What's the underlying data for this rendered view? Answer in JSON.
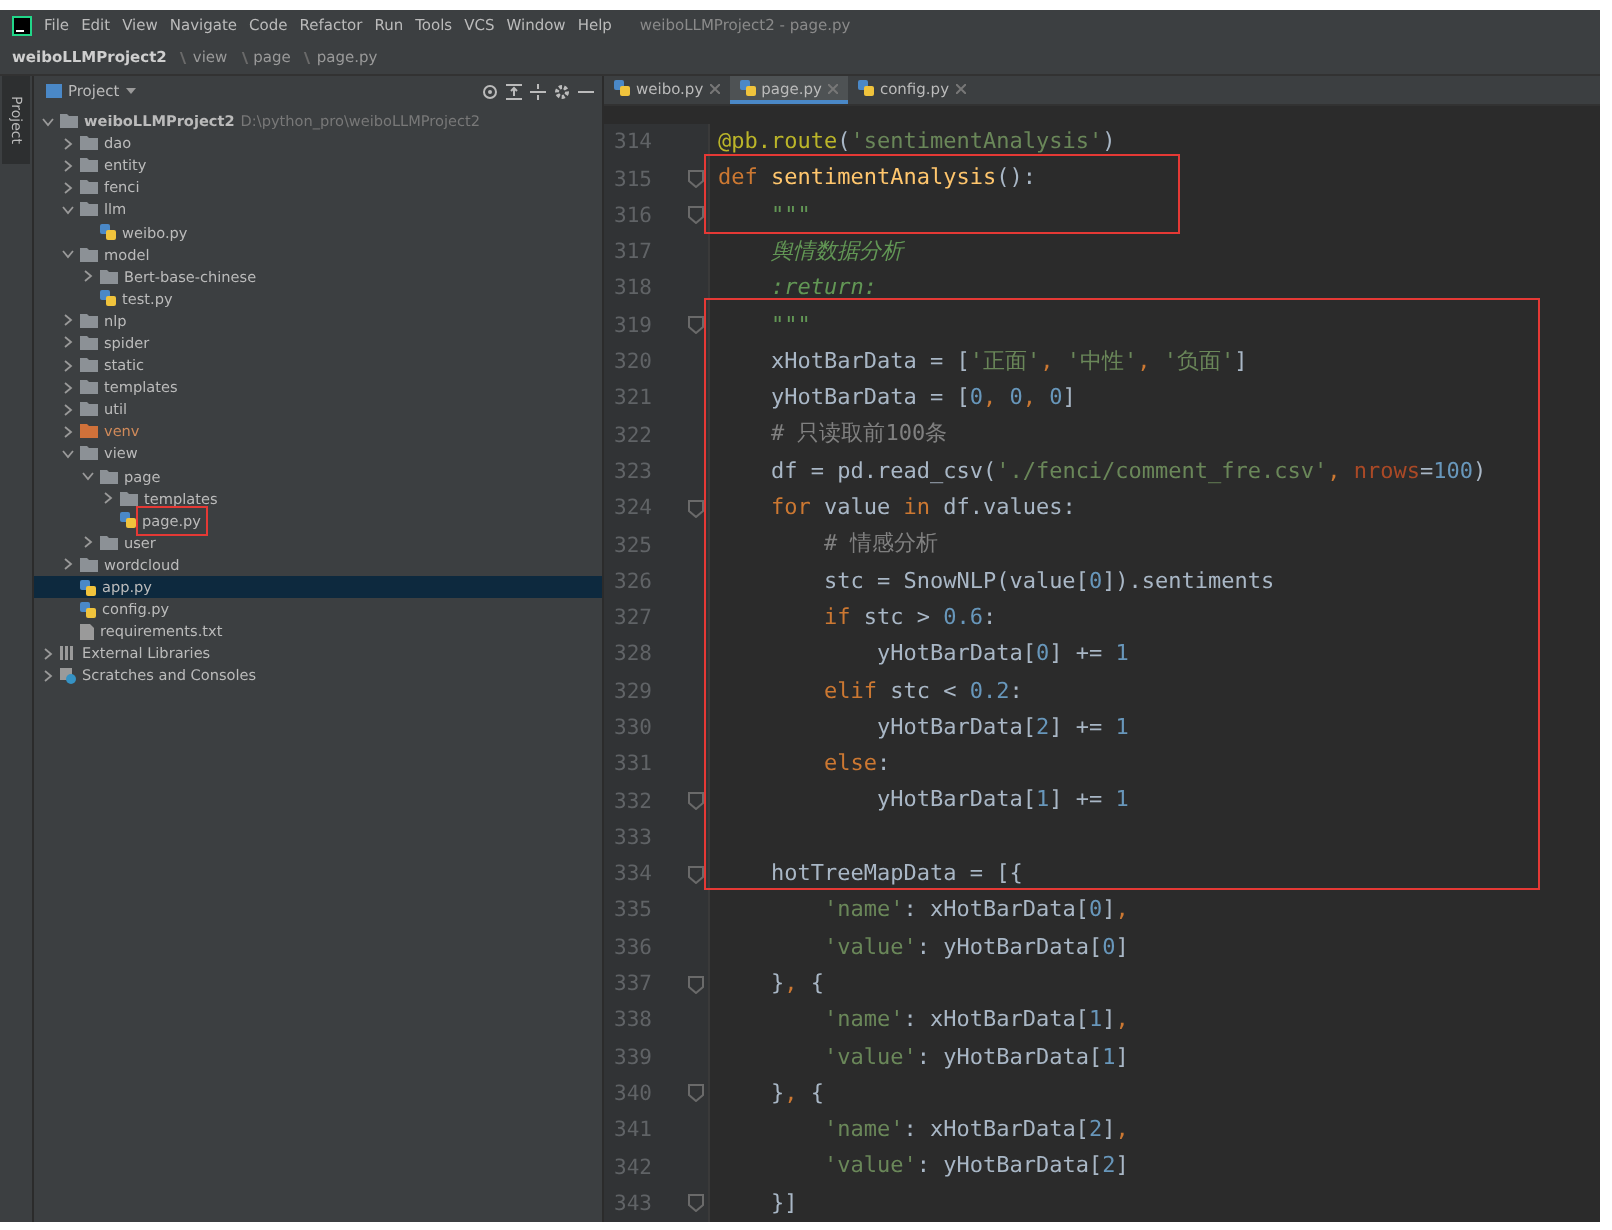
{
  "menu_bar": {
    "items": [
      "File",
      "Edit",
      "View",
      "Navigate",
      "Code",
      "Refactor",
      "Run",
      "Tools",
      "VCS",
      "Window",
      "Help"
    ],
    "title": "weiboLLMProject2 - page.py"
  },
  "breadcrumb": [
    "weiboLLMProject2",
    "view",
    "page",
    "page.py"
  ],
  "left_stripe": {
    "label": "Project"
  },
  "project_panel": {
    "title": "Project",
    "tree": [
      {
        "kind": "folder",
        "label": "weiboLLMProject2",
        "path": "D:\\python_pro\\weiboLLMProject2",
        "expanded": true,
        "selected": false,
        "children": [
          {
            "kind": "folder",
            "label": "dao",
            "expanded": false,
            "selected": false
          },
          {
            "kind": "folder",
            "label": "entity",
            "expanded": false,
            "selected": false
          },
          {
            "kind": "folder",
            "label": "fenci",
            "expanded": false,
            "selected": false
          },
          {
            "kind": "folder",
            "label": "llm",
            "expanded": true,
            "selected": false,
            "children": [
              {
                "kind": "python",
                "label": "weibo.py",
                "selected": false
              }
            ]
          },
          {
            "kind": "folder",
            "label": "model",
            "expanded": true,
            "selected": false,
            "children": [
              {
                "kind": "folder",
                "label": "Bert-base-chinese",
                "expanded": false,
                "selected": false
              },
              {
                "kind": "python",
                "label": "test.py",
                "selected": false
              }
            ]
          },
          {
            "kind": "folder",
            "label": "nlp",
            "expanded": false,
            "selected": false
          },
          {
            "kind": "folder",
            "label": "spider",
            "expanded": false,
            "selected": false
          },
          {
            "kind": "folder",
            "label": "static",
            "expanded": false,
            "selected": false
          },
          {
            "kind": "folder",
            "label": "templates",
            "expanded": false,
            "selected": false
          },
          {
            "kind": "folder",
            "label": "util",
            "expanded": false,
            "selected": false
          },
          {
            "kind": "excluded",
            "label": "venv",
            "expanded": false,
            "selected": false
          },
          {
            "kind": "folder",
            "label": "view",
            "expanded": true,
            "selected": false,
            "children": [
              {
                "kind": "folder",
                "label": "page",
                "expanded": true,
                "selected": false,
                "children": [
                  {
                    "kind": "folder",
                    "label": "templates",
                    "expanded": false,
                    "selected": false
                  },
                  {
                    "kind": "python",
                    "label": "page.py",
                    "selected": false,
                    "highlighted": true
                  }
                ]
              },
              {
                "kind": "folder",
                "label": "user",
                "expanded": false,
                "selected": false
              }
            ]
          },
          {
            "kind": "folder",
            "label": "wordcloud",
            "expanded": false,
            "selected": false
          },
          {
            "kind": "python",
            "label": "app.py",
            "selected": true
          },
          {
            "kind": "python",
            "label": "config.py",
            "selected": false
          },
          {
            "kind": "text",
            "label": "requirements.txt",
            "selected": false
          }
        ]
      },
      {
        "kind": "library",
        "label": "External Libraries",
        "expanded": false,
        "selected": false
      },
      {
        "kind": "scratches",
        "label": "Scratches and Consoles",
        "expanded": false,
        "selected": false
      }
    ]
  },
  "editor": {
    "tabs": [
      {
        "label": "weibo.py",
        "selected": false
      },
      {
        "label": "page.py",
        "selected": true
      },
      {
        "label": "config.py",
        "selected": false
      }
    ],
    "lines": [
      {
        "number": "314",
        "fold": false,
        "tokens": [
          {
            "kind": "decorator",
            "text": "@pb.route"
          },
          {
            "kind": "plain",
            "text": "("
          },
          {
            "kind": "string",
            "text": "'sentimentAnalysis'"
          },
          {
            "kind": "plain",
            "text": ")"
          }
        ]
      },
      {
        "number": "315",
        "fold": true,
        "tokens": [
          {
            "kind": "keyword",
            "text": "def "
          },
          {
            "kind": "function",
            "text": "sentimentAnalysis"
          },
          {
            "kind": "plain",
            "text": "():"
          }
        ]
      },
      {
        "number": "316",
        "fold": true,
        "tokens": [
          {
            "kind": "docstring",
            "text": "    \"\"\""
          }
        ]
      },
      {
        "number": "317",
        "fold": false,
        "tokens": [
          {
            "kind": "docstring",
            "text": "    舆情数据分析"
          }
        ]
      },
      {
        "number": "318",
        "fold": false,
        "tokens": [
          {
            "kind": "docstring",
            "text": "    :return:"
          }
        ]
      },
      {
        "number": "319",
        "fold": true,
        "tokens": [
          {
            "kind": "docstring",
            "text": "    \"\"\""
          }
        ]
      },
      {
        "number": "320",
        "fold": false,
        "tokens": [
          {
            "kind": "plain",
            "text": "    xHotBarData = ["
          },
          {
            "kind": "string",
            "text": "'正面'"
          },
          {
            "kind": "keyword",
            "text": ", "
          },
          {
            "kind": "string",
            "text": "'中性'"
          },
          {
            "kind": "keyword",
            "text": ", "
          },
          {
            "kind": "string",
            "text": "'负面'"
          },
          {
            "kind": "plain",
            "text": "]"
          }
        ]
      },
      {
        "number": "321",
        "fold": false,
        "tokens": [
          {
            "kind": "plain",
            "text": "    yHotBarData = ["
          },
          {
            "kind": "number",
            "text": "0"
          },
          {
            "kind": "keyword",
            "text": ", "
          },
          {
            "kind": "number",
            "text": "0"
          },
          {
            "kind": "keyword",
            "text": ", "
          },
          {
            "kind": "number",
            "text": "0"
          },
          {
            "kind": "plain",
            "text": "]"
          }
        ]
      },
      {
        "number": "322",
        "fold": false,
        "tokens": [
          {
            "kind": "comment",
            "text": "    # 只读取前100条"
          }
        ]
      },
      {
        "number": "323",
        "fold": false,
        "tokens": [
          {
            "kind": "plain",
            "text": "    df = pd.read_csv("
          },
          {
            "kind": "string",
            "text": "'./fenci/comment_fre.csv'"
          },
          {
            "kind": "keyword",
            "text": ", "
          },
          {
            "kind": "param",
            "text": "nrows"
          },
          {
            "kind": "plain",
            "text": "="
          },
          {
            "kind": "number",
            "text": "100"
          },
          {
            "kind": "plain",
            "text": ")"
          }
        ]
      },
      {
        "number": "324",
        "fold": true,
        "tokens": [
          {
            "kind": "keyword",
            "text": "    for "
          },
          {
            "kind": "plain",
            "text": "value "
          },
          {
            "kind": "keyword",
            "text": "in "
          },
          {
            "kind": "plain",
            "text": "df.values:"
          }
        ]
      },
      {
        "number": "325",
        "fold": false,
        "tokens": [
          {
            "kind": "comment",
            "text": "        # 情感分析"
          }
        ]
      },
      {
        "number": "326",
        "fold": false,
        "tokens": [
          {
            "kind": "plain",
            "text": "        stc = SnowNLP(value["
          },
          {
            "kind": "number",
            "text": "0"
          },
          {
            "kind": "plain",
            "text": "]).sentiments"
          }
        ]
      },
      {
        "number": "327",
        "fold": false,
        "tokens": [
          {
            "kind": "keyword",
            "text": "        if "
          },
          {
            "kind": "plain",
            "text": "stc > "
          },
          {
            "kind": "number",
            "text": "0.6"
          },
          {
            "kind": "plain",
            "text": ":"
          }
        ]
      },
      {
        "number": "328",
        "fold": false,
        "tokens": [
          {
            "kind": "plain",
            "text": "            yHotBarData["
          },
          {
            "kind": "number",
            "text": "0"
          },
          {
            "kind": "plain",
            "text": "] += "
          },
          {
            "kind": "number",
            "text": "1"
          }
        ]
      },
      {
        "number": "329",
        "fold": false,
        "tokens": [
          {
            "kind": "keyword",
            "text": "        elif "
          },
          {
            "kind": "plain",
            "text": "stc < "
          },
          {
            "kind": "number",
            "text": "0.2"
          },
          {
            "kind": "plain",
            "text": ":"
          }
        ]
      },
      {
        "number": "330",
        "fold": false,
        "tokens": [
          {
            "kind": "plain",
            "text": "            yHotBarData["
          },
          {
            "kind": "number",
            "text": "2"
          },
          {
            "kind": "plain",
            "text": "] += "
          },
          {
            "kind": "number",
            "text": "1"
          }
        ]
      },
      {
        "number": "331",
        "fold": false,
        "tokens": [
          {
            "kind": "keyword",
            "text": "        else"
          },
          {
            "kind": "plain",
            "text": ":"
          }
        ]
      },
      {
        "number": "332",
        "fold": true,
        "tokens": [
          {
            "kind": "plain",
            "text": "            yHotBarData["
          },
          {
            "kind": "number",
            "text": "1"
          },
          {
            "kind": "plain",
            "text": "] += "
          },
          {
            "kind": "number",
            "text": "1"
          }
        ]
      },
      {
        "number": "333",
        "fold": false
      },
      {
        "number": "334",
        "fold": true,
        "tokens": [
          {
            "kind": "plain",
            "text": "    hotTreeMapData = [{"
          }
        ]
      },
      {
        "number": "335",
        "fold": false,
        "tokens": [
          {
            "kind": "string",
            "text": "        'name'"
          },
          {
            "kind": "plain",
            "text": ": xHotBarData["
          },
          {
            "kind": "number",
            "text": "0"
          },
          {
            "kind": "plain",
            "text": "]"
          },
          {
            "kind": "keyword",
            "text": ","
          }
        ]
      },
      {
        "number": "336",
        "fold": false,
        "tokens": [
          {
            "kind": "string",
            "text": "        'value'"
          },
          {
            "kind": "plain",
            "text": ": yHotBarData["
          },
          {
            "kind": "number",
            "text": "0"
          },
          {
            "kind": "plain",
            "text": "]"
          }
        ]
      },
      {
        "number": "337",
        "fold": true,
        "tokens": [
          {
            "kind": "plain",
            "text": "    }"
          },
          {
            "kind": "keyword",
            "text": ", "
          },
          {
            "kind": "plain",
            "text": "{"
          }
        ]
      },
      {
        "number": "338",
        "fold": false,
        "tokens": [
          {
            "kind": "string",
            "text": "        'name'"
          },
          {
            "kind": "plain",
            "text": ": xHotBarData["
          },
          {
            "kind": "number",
            "text": "1"
          },
          {
            "kind": "plain",
            "text": "]"
          },
          {
            "kind": "keyword",
            "text": ","
          }
        ]
      },
      {
        "number": "339",
        "fold": false,
        "tokens": [
          {
            "kind": "string",
            "text": "        'value'"
          },
          {
            "kind": "plain",
            "text": ": yHotBarData["
          },
          {
            "kind": "number",
            "text": "1"
          },
          {
            "kind": "plain",
            "text": "]"
          }
        ]
      },
      {
        "number": "340",
        "fold": true,
        "tokens": [
          {
            "kind": "plain",
            "text": "    }"
          },
          {
            "kind": "keyword",
            "text": ", "
          },
          {
            "kind": "plain",
            "text": "{"
          }
        ]
      },
      {
        "number": "341",
        "fold": false,
        "tokens": [
          {
            "kind": "string",
            "text": "        'name'"
          },
          {
            "kind": "plain",
            "text": ": xHotBarData["
          },
          {
            "kind": "number",
            "text": "2"
          },
          {
            "kind": "plain",
            "text": "]"
          },
          {
            "kind": "keyword",
            "text": ","
          }
        ]
      },
      {
        "number": "342",
        "fold": false,
        "tokens": [
          {
            "kind": "string",
            "text": "        'value'"
          },
          {
            "kind": "plain",
            "text": ": yHotBarData["
          },
          {
            "kind": "number",
            "text": "2"
          },
          {
            "kind": "plain",
            "text": "]"
          }
        ]
      },
      {
        "number": "343",
        "fold": true,
        "tokens": [
          {
            "kind": "plain",
            "text": "    }]"
          }
        ]
      }
    ]
  }
}
